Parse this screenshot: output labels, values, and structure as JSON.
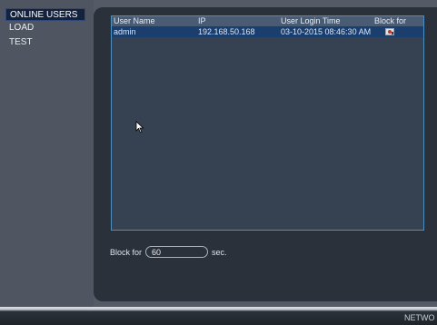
{
  "sidebar": {
    "items": [
      {
        "label": "ONLINE USERS",
        "active": true
      },
      {
        "label": "LOAD",
        "active": false
      },
      {
        "label": "TEST",
        "active": false
      }
    ]
  },
  "table": {
    "headers": [
      "User Name",
      "IP",
      "User Login Time",
      "Block for"
    ],
    "rows": [
      {
        "user": "admin",
        "ip": "192.168.50.168",
        "login_time": "03-10-2015 08:46:30 AM",
        "block_icon": "block-user-icon"
      }
    ]
  },
  "block": {
    "label": "Block for",
    "value": "60",
    "unit": "sec."
  },
  "footer": {
    "text": "NETWO"
  },
  "colors": {
    "background": "#545b66",
    "panel": "#2b313a",
    "table_header": "#4a5c74",
    "row_selected": "#1a3f6e",
    "active_tab": "#14223d",
    "table_border": "#4a8fbf"
  }
}
